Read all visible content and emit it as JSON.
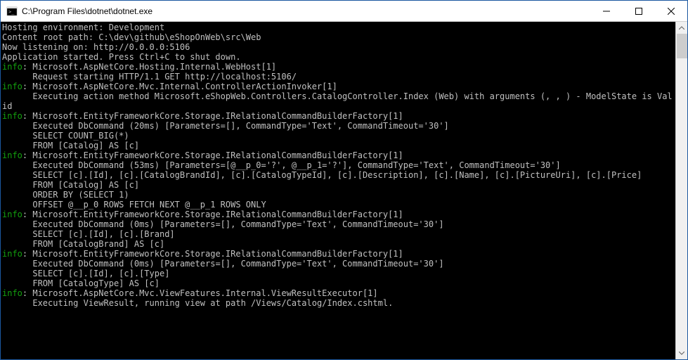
{
  "window": {
    "title": "C:\\Program Files\\dotnet\\dotnet.exe"
  },
  "console": {
    "info_label": "info",
    "lines": [
      {
        "type": "plain",
        "text": "Hosting environment: Development"
      },
      {
        "type": "plain",
        "text": "Content root path: C:\\dev\\github\\eShopOnWeb\\src\\Web"
      },
      {
        "type": "plain",
        "text": "Now listening on: http://0.0.0.0:5106"
      },
      {
        "type": "plain",
        "text": "Application started. Press Ctrl+C to shut down."
      },
      {
        "type": "info",
        "text": ": Microsoft.AspNetCore.Hosting.Internal.WebHost[1]"
      },
      {
        "type": "indent",
        "text": "Request starting HTTP/1.1 GET http://localhost:5106/"
      },
      {
        "type": "info",
        "text": ": Microsoft.AspNetCore.Mvc.Internal.ControllerActionInvoker[1]"
      },
      {
        "type": "indent",
        "text": "Executing action method Microsoft.eShopWeb.Controllers.CatalogController.Index (Web) with arguments (, , ) - ModelState is Valid"
      },
      {
        "type": "info",
        "text": ": Microsoft.EntityFrameworkCore.Storage.IRelationalCommandBuilderFactory[1]"
      },
      {
        "type": "indent",
        "text": "Executed DbCommand (20ms) [Parameters=[], CommandType='Text', CommandTimeout='30']"
      },
      {
        "type": "indent",
        "text": "SELECT COUNT_BIG(*)"
      },
      {
        "type": "indent",
        "text": "FROM [Catalog] AS [c]"
      },
      {
        "type": "info",
        "text": ": Microsoft.EntityFrameworkCore.Storage.IRelationalCommandBuilderFactory[1]"
      },
      {
        "type": "indent",
        "text": "Executed DbCommand (53ms) [Parameters=[@__p_0='?', @__p_1='?'], CommandType='Text', CommandTimeout='30']"
      },
      {
        "type": "indent",
        "text": "SELECT [c].[Id], [c].[CatalogBrandId], [c].[CatalogTypeId], [c].[Description], [c].[Name], [c].[PictureUri], [c].[Price]"
      },
      {
        "type": "indent",
        "text": "FROM [Catalog] AS [c]"
      },
      {
        "type": "indent",
        "text": "ORDER BY (SELECT 1)"
      },
      {
        "type": "indent",
        "text": "OFFSET @__p_0 ROWS FETCH NEXT @__p_1 ROWS ONLY"
      },
      {
        "type": "info",
        "text": ": Microsoft.EntityFrameworkCore.Storage.IRelationalCommandBuilderFactory[1]"
      },
      {
        "type": "indent",
        "text": "Executed DbCommand (0ms) [Parameters=[], CommandType='Text', CommandTimeout='30']"
      },
      {
        "type": "indent",
        "text": "SELECT [c].[Id], [c].[Brand]"
      },
      {
        "type": "indent",
        "text": "FROM [CatalogBrand] AS [c]"
      },
      {
        "type": "info",
        "text": ": Microsoft.EntityFrameworkCore.Storage.IRelationalCommandBuilderFactory[1]"
      },
      {
        "type": "indent",
        "text": "Executed DbCommand (0ms) [Parameters=[], CommandType='Text', CommandTimeout='30']"
      },
      {
        "type": "indent",
        "text": "SELECT [c].[Id], [c].[Type]"
      },
      {
        "type": "indent",
        "text": "FROM [CatalogType] AS [c]"
      },
      {
        "type": "info",
        "text": ": Microsoft.AspNetCore.Mvc.ViewFeatures.Internal.ViewResultExecutor[1]"
      },
      {
        "type": "indent",
        "text": "Executing ViewResult, running view at path /Views/Catalog/Index.cshtml."
      }
    ]
  }
}
